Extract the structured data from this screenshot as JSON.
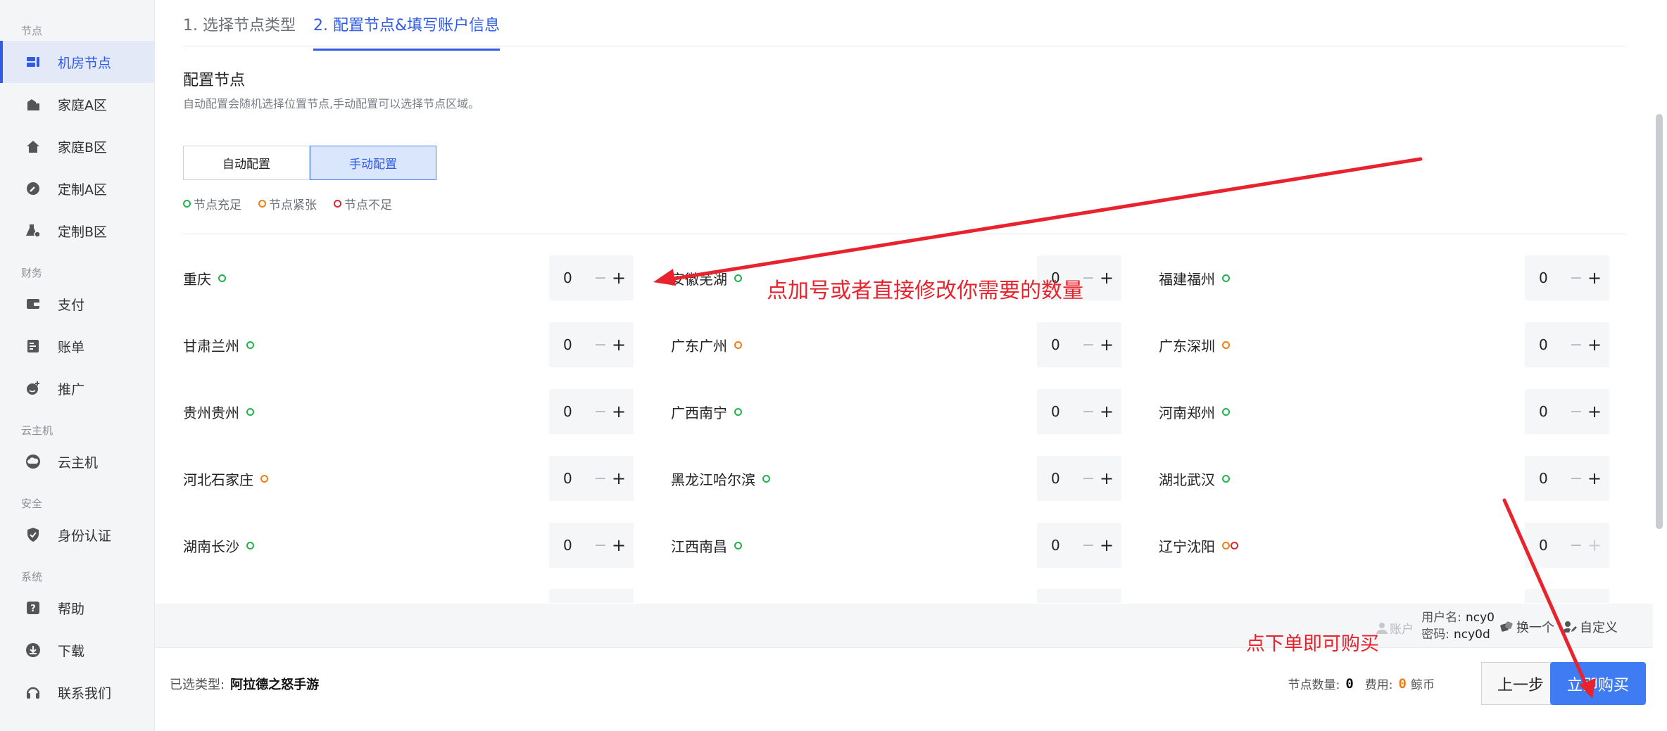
{
  "sidebar": {
    "groups": [
      {
        "title": "节点",
        "items": [
          {
            "label": "机房节点",
            "icon": "server-icon",
            "active": true
          },
          {
            "label": "家庭A区",
            "icon": "building-icon"
          },
          {
            "label": "家庭B区",
            "icon": "home-icon"
          }
        ]
      },
      {
        "title": "",
        "items": [
          {
            "label": "定制A区",
            "icon": "wrench-icon"
          },
          {
            "label": "定制B区",
            "icon": "flask-gear-icon"
          }
        ]
      },
      {
        "title": "财务",
        "items": [
          {
            "label": "支付",
            "icon": "wallet-icon"
          },
          {
            "label": "账单",
            "icon": "bill-icon"
          },
          {
            "label": "推广",
            "icon": "smile-plus-icon"
          }
        ]
      },
      {
        "title": "云主机",
        "items": [
          {
            "label": "云主机",
            "icon": "cloud-icon"
          }
        ]
      },
      {
        "title": "安全",
        "items": [
          {
            "label": "身份认证",
            "icon": "shield-check-icon"
          }
        ]
      },
      {
        "title": "系统",
        "items": [
          {
            "label": "帮助",
            "icon": "help-icon"
          },
          {
            "label": "下载",
            "icon": "download-icon"
          },
          {
            "label": "联系我们",
            "icon": "headset-icon"
          }
        ]
      }
    ]
  },
  "steps": {
    "step1": "1. 选择节点类型",
    "step2": "2. 配置节点&填写账户信息"
  },
  "config": {
    "title": "配置节点",
    "desc": "自动配置会随机选择位置节点,手动配置可以选择节点区域。",
    "mode_auto": "自动配置",
    "mode_manual": "手动配置"
  },
  "legend": {
    "sufficient": "节点充足",
    "tight": "节点紧张",
    "insufficient": "节点不足"
  },
  "status_colors": {
    "green": "#22b14c",
    "orange": "#f07d14",
    "red": "#d92638"
  },
  "regions": [
    {
      "name": "重庆",
      "status": [
        "green"
      ],
      "count": "0"
    },
    {
      "name": "安徽芜湖",
      "status": [
        "green"
      ],
      "count": "0"
    },
    {
      "name": "福建福州",
      "status": [
        "green"
      ],
      "count": "0"
    },
    {
      "name": "甘肃兰州",
      "status": [
        "green"
      ],
      "count": "0"
    },
    {
      "name": "广东广州",
      "status": [
        "orange"
      ],
      "count": "0"
    },
    {
      "name": "广东深圳",
      "status": [
        "orange"
      ],
      "count": "0"
    },
    {
      "name": "贵州贵州",
      "status": [
        "green"
      ],
      "count": "0"
    },
    {
      "name": "广西南宁",
      "status": [
        "green"
      ],
      "count": "0"
    },
    {
      "name": "河南郑州",
      "status": [
        "green"
      ],
      "count": "0"
    },
    {
      "name": "河北石家庄",
      "status": [
        "orange"
      ],
      "count": "0"
    },
    {
      "name": "黑龙江哈尔滨",
      "status": [
        "green"
      ],
      "count": "0"
    },
    {
      "name": "湖北武汉",
      "status": [
        "green"
      ],
      "count": "0"
    },
    {
      "name": "湖南长沙",
      "status": [
        "green"
      ],
      "count": "0"
    },
    {
      "name": "江西南昌",
      "status": [
        "green"
      ],
      "count": "0"
    },
    {
      "name": "辽宁沈阳",
      "status": [
        "orange",
        "red"
      ],
      "count": "0",
      "plus_disabled": true
    }
  ],
  "stepper": {
    "minus": "−",
    "plus": "+"
  },
  "account": {
    "label": "账户",
    "username_label": "用户名:",
    "username": "ncy0",
    "password_label": "密码:",
    "password": "ncy0d",
    "change": "换一个",
    "custom": "自定义"
  },
  "footer": {
    "selected_label": "已选类型:",
    "selected_value": "阿拉德之怒手游",
    "count_label": "节点数量:",
    "count_value": "0",
    "fee_label": "费用:",
    "fee_value": "0",
    "currency": "鲸币",
    "prev": "上一步",
    "buy": "立即购买"
  },
  "annotations": {
    "hint_plus": "点加号或者直接修改你需要的数量",
    "hint_buy": "点下单即可购买",
    "color": "#e8232d"
  }
}
